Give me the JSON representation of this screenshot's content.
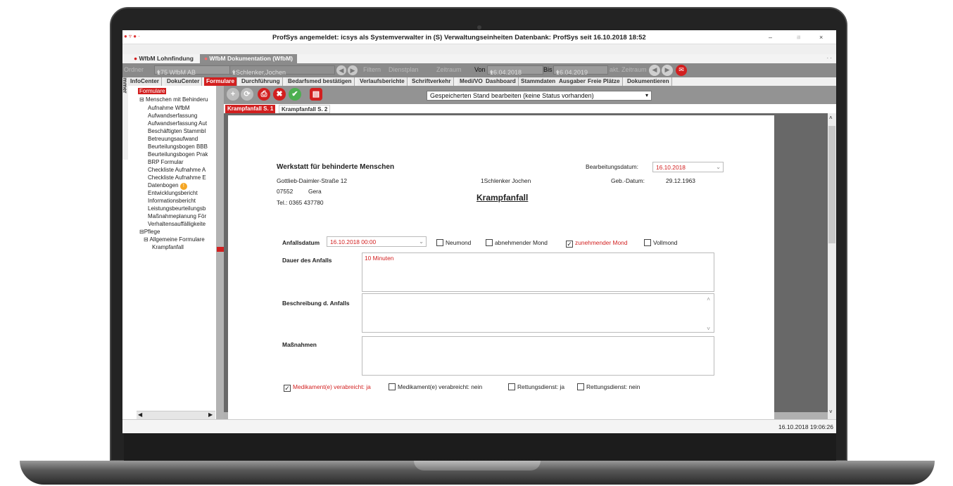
{
  "window": {
    "title": "ProfSys angemeldet: icsys als Systemverwalter in (S) Verwaltungseinheiten Datenbank: ProfSys seit 16.10.2018 18:52",
    "minimize": "–",
    "maximize": "◽",
    "close": "×"
  },
  "app_tabs": [
    "WfbM Lohnfindung",
    "WfbM Dokumentation (WfbM)"
  ],
  "side_label": "Arbeitszimmer",
  "filterbar": {
    "ordner_label": "Ordner",
    "ordner_value": "175 WfbM AB",
    "person_value": "1Schlenker,Jochen",
    "filtern": "Filtern",
    "dienstplan": "Dienstplan",
    "zeitraum": "Zeitraum",
    "von_label": "Von",
    "von_value": "16.04.2018",
    "bis_label": "Bis",
    "bis_value": "16.04.2019",
    "akt_zeitraum": "akt. Zeitraum"
  },
  "menu": [
    "InfoCenter",
    "DokuCenter",
    "Formulare",
    "Durchführung",
    "Bedarfsmed bestätigen",
    "Verlaufsberichte",
    "Schriftverkehr",
    "Medi/VO",
    "Dashboard",
    "Stammdaten",
    "Ausgaben",
    "Freie Plätze",
    "Dokumentieren"
  ],
  "tree": {
    "root": "Formulare",
    "group1": "Menschen mit Behinderu",
    "items": [
      "Aufnahme WfbM",
      "Aufwandserfassung",
      "Aufwandserfassung Aut",
      "Beschäftigten Stammbl",
      "Betreuungsaufwand",
      "Beurteilungsbogen BBB",
      "Beurteilungsbogen Prak",
      "BRP Formular",
      "Checkliste Aufnahme A",
      "Checkliste Aufnahme E",
      "Datenbogen",
      "Entwicklungsbericht",
      "Informationsbericht",
      "Leistungsbeurteilungsb",
      "Maßnahmeplanung För",
      "Verhaltensauffälligkeite"
    ],
    "group2": "Pflege",
    "group2_sub": "Allgemeine Formulare",
    "group2_leaf": "Krampfanfall"
  },
  "action_bar": {
    "state_select": "Gespeicherten Stand bearbeiten (keine Status vorhanden)"
  },
  "page_tabs": [
    "Krampfanfall S. 1",
    "Krampfanfall S. 2"
  ],
  "form": {
    "org_name": "Werkstatt für behinderte Menschen",
    "street": "Gottlieb-Daimler-Straße 12",
    "zip": "07552",
    "city": "Gera",
    "phone": "Tel.: 0365 437780",
    "person": "1Schlenker  Jochen",
    "title": "Krampfanfall",
    "bearbeitungsdatum_label": "Bearbeitungsdatum:",
    "bearbeitungsdatum": "16.10.2018",
    "geb_label": "Geb.-Datum:",
    "geb_datum": "29.12.1963",
    "anfallsdatum_label": "Anfallsdatum",
    "anfallsdatum": "16.10.2018 00:00",
    "moon": [
      {
        "label": "Neumond",
        "checked": false
      },
      {
        "label": "abnehmender Mond",
        "checked": false
      },
      {
        "label": "zunehmender Mond",
        "checked": true
      },
      {
        "label": "Vollmond",
        "checked": false
      }
    ],
    "dauer_label": "Dauer des Anfalls",
    "dauer_value": "10 Minuten",
    "beschreibung_label": "Beschreibung d. Anfalls",
    "massnahmen_label": "Maßnahmen",
    "bottom_checks": [
      {
        "label": "Medikament(e) verabreicht: ja",
        "checked": true
      },
      {
        "label": "Medikament(e) verabreicht: nein",
        "checked": false
      },
      {
        "label": "Rettungsdienst: ja",
        "checked": false
      },
      {
        "label": "Rettungsdienst: nein",
        "checked": false
      }
    ]
  },
  "status": {
    "datetime": "16.10.2018 19:06:26"
  },
  "colors": {
    "accent": "#d21f1f",
    "toolbar": "#8a8a8a"
  }
}
